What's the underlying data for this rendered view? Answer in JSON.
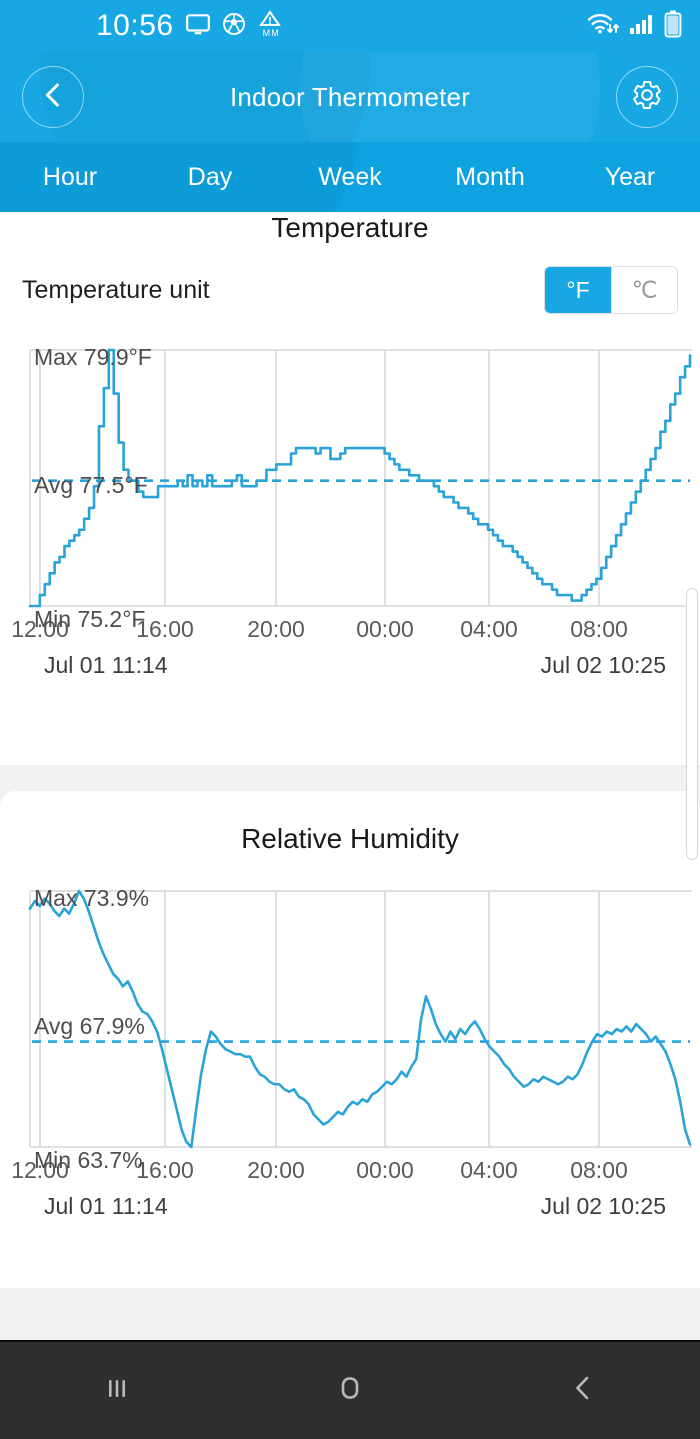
{
  "status_bar": {
    "time": "10:56",
    "icons": [
      "cast-screen-icon",
      "soccer-ball-icon",
      "warning-mm-icon",
      "wifi-icon",
      "cell-signal-icon",
      "battery-icon"
    ]
  },
  "app_bar": {
    "title": "Indoor Thermometer",
    "back_icon": "chevron-left-icon",
    "settings_icon": "gear-icon"
  },
  "tabs": [
    {
      "label": "Hour"
    },
    {
      "label": "Day"
    },
    {
      "label": "Week"
    },
    {
      "label": "Month"
    },
    {
      "label": "Year"
    }
  ],
  "active_tab": "Day",
  "temperature_card": {
    "title": "Temperature",
    "unit_label": "Temperature unit",
    "unit_options": [
      {
        "label": "°F",
        "selected": true
      },
      {
        "label": "℃",
        "selected": false
      }
    ],
    "max_label": "Max 79.9°F",
    "avg_label": "Avg 77.5°F",
    "min_label": "Min 75.2°F",
    "start_time": "Jul 01 11:14",
    "end_time": "Jul 02 10:25"
  },
  "humidity_card": {
    "title": "Relative Humidity",
    "max_label": "Max 73.9%",
    "avg_label": "Avg 67.9%",
    "min_label": "Min 63.7%",
    "start_time": "Jul 01 11:14",
    "end_time": "Jul 02 10:25"
  },
  "axis_ticks": [
    "12:00",
    "16:00",
    "20:00",
    "00:00",
    "04:00",
    "08:00"
  ],
  "nav_bar": {
    "recents_icon": "recents-icon",
    "home_icon": "home-icon",
    "back_icon": "back-icon"
  },
  "colors": {
    "accent": "#17a8e4",
    "tabbar": "#0fa2e0",
    "line": "#29a3d8",
    "grid": "#e0e0e0",
    "background": "#f1f1f1",
    "navbar": "#2e2e2e"
  },
  "chart_data": [
    {
      "type": "line",
      "title": "Temperature",
      "xlabel": "",
      "ylabel": "°F",
      "unit": "°F",
      "max": 79.9,
      "avg": 77.5,
      "min": 75.2,
      "ylim": [
        75.2,
        79.9
      ],
      "grid": true,
      "legend": "none",
      "x_tick_labels": [
        "12:00",
        "16:00",
        "20:00",
        "00:00",
        "04:00",
        "08:00"
      ],
      "x_start": "Jul 01 11:14",
      "x_end": "Jul 02 10:25",
      "avg_reference_line": 77.5,
      "values": [
        75.2,
        75.2,
        75.4,
        75.6,
        75.8,
        76.0,
        76.1,
        76.3,
        76.4,
        76.5,
        76.6,
        76.8,
        77.0,
        77.4,
        78.5,
        79.2,
        79.9,
        79.1,
        78.2,
        77.7,
        77.5,
        77.5,
        77.3,
        77.2,
        77.2,
        77.2,
        77.4,
        77.4,
        77.4,
        77.4,
        77.5,
        77.4,
        77.6,
        77.4,
        77.5,
        77.4,
        77.6,
        77.4,
        77.4,
        77.4,
        77.4,
        77.5,
        77.6,
        77.4,
        77.4,
        77.4,
        77.5,
        77.5,
        77.7,
        77.7,
        77.8,
        77.8,
        77.8,
        78.0,
        78.1,
        78.1,
        78.1,
        78.1,
        78.0,
        78.1,
        78.1,
        77.9,
        77.9,
        78.0,
        78.1,
        78.1,
        78.1,
        78.1,
        78.1,
        78.1,
        78.1,
        78.1,
        78.0,
        77.9,
        77.8,
        77.7,
        77.7,
        77.6,
        77.6,
        77.5,
        77.5,
        77.5,
        77.4,
        77.3,
        77.2,
        77.2,
        77.1,
        77.0,
        77.0,
        76.9,
        76.8,
        76.7,
        76.7,
        76.6,
        76.5,
        76.4,
        76.3,
        76.3,
        76.2,
        76.1,
        76.0,
        75.9,
        75.8,
        75.7,
        75.6,
        75.6,
        75.5,
        75.4,
        75.4,
        75.4,
        75.3,
        75.3,
        75.4,
        75.5,
        75.6,
        75.7,
        75.9,
        76.1,
        76.3,
        76.5,
        76.7,
        76.9,
        77.1,
        77.3,
        77.5,
        77.7,
        77.9,
        78.1,
        78.4,
        78.6,
        78.9,
        79.1,
        79.4,
        79.6,
        79.8
      ]
    },
    {
      "type": "line",
      "title": "Relative Humidity",
      "xlabel": "",
      "ylabel": "%",
      "unit": "%",
      "max": 73.9,
      "avg": 67.9,
      "min": 63.7,
      "ylim": [
        63.7,
        73.9
      ],
      "grid": true,
      "legend": "none",
      "x_tick_labels": [
        "12:00",
        "16:00",
        "20:00",
        "00:00",
        "04:00",
        "08:00"
      ],
      "x_start": "Jul 01 11:14",
      "x_end": "Jul 02 10:25",
      "avg_reference_line": 67.9,
      "values": [
        73.2,
        73.5,
        73.3,
        73.6,
        73.4,
        73.1,
        72.9,
        73.2,
        73.0,
        73.4,
        73.9,
        73.6,
        73.1,
        72.5,
        71.9,
        71.4,
        71.0,
        70.6,
        70.4,
        70.1,
        70.3,
        69.9,
        69.4,
        69.1,
        69.0,
        68.7,
        68.3,
        67.6,
        66.8,
        66.0,
        65.2,
        64.4,
        63.9,
        63.7,
        65.2,
        66.6,
        67.6,
        68.3,
        68.1,
        67.8,
        67.6,
        67.5,
        67.4,
        67.4,
        67.3,
        67.3,
        66.9,
        66.6,
        66.5,
        66.3,
        66.2,
        66.2,
        66.0,
        65.9,
        66.0,
        65.7,
        65.6,
        65.4,
        65.0,
        64.8,
        64.6,
        64.7,
        64.9,
        65.1,
        65.0,
        65.3,
        65.5,
        65.4,
        65.6,
        65.5,
        65.8,
        65.9,
        66.1,
        66.3,
        66.2,
        66.4,
        66.7,
        66.5,
        66.9,
        67.2,
        68.8,
        69.7,
        69.2,
        68.6,
        68.2,
        67.9,
        68.3,
        68.0,
        68.4,
        68.2,
        68.5,
        68.7,
        68.4,
        68.0,
        67.7,
        67.5,
        67.3,
        67.0,
        66.8,
        66.5,
        66.3,
        66.1,
        66.2,
        66.4,
        66.3,
        66.5,
        66.4,
        66.3,
        66.2,
        66.3,
        66.5,
        66.4,
        66.6,
        67.0,
        67.5,
        67.9,
        68.2,
        68.1,
        68.3,
        68.2,
        68.4,
        68.3,
        68.5,
        68.3,
        68.6,
        68.4,
        68.2,
        67.9,
        68.1,
        67.8,
        67.5,
        67.0,
        66.4,
        65.5,
        64.4,
        63.8
      ]
    }
  ]
}
